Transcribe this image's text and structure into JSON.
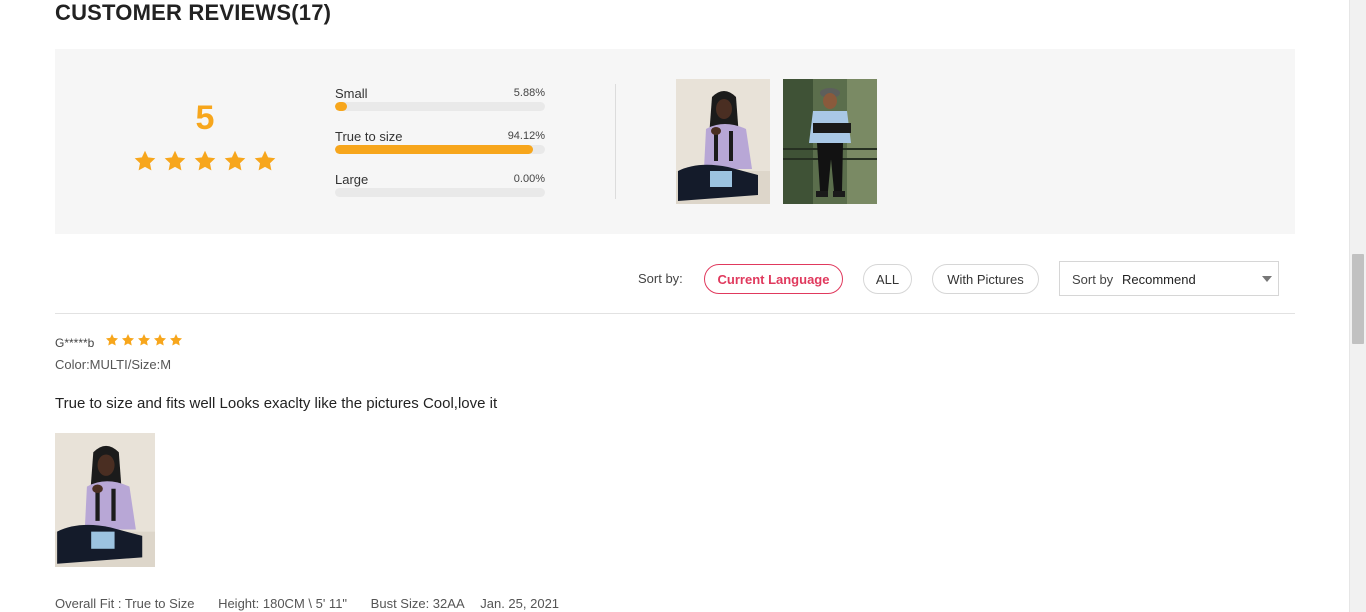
{
  "title": "CUSTOMER REVIEWS(17)",
  "summary": {
    "average": "5",
    "average_stars": 5,
    "fit": [
      {
        "label": "Small",
        "percent_text": "5.88%",
        "percent": 5.88
      },
      {
        "label": "True to size",
        "percent_text": "94.12%",
        "percent": 94.12
      },
      {
        "label": "Large",
        "percent_text": "0.00%",
        "percent": 0
      }
    ],
    "photos": [
      "customer-photo-seated",
      "customer-photo-standing"
    ]
  },
  "sort": {
    "label": "Sort by:",
    "filters": [
      "Current Language",
      "ALL",
      "With Pictures"
    ],
    "active_filter": "Current Language",
    "select_prefix": "Sort by",
    "select_value": "Recommend"
  },
  "review": {
    "reviewer": "G*****b",
    "stars": 5,
    "variant": "Color:MULTI/Size:M",
    "comment": "True to size and fits well Looks exaclty like the pictures Cool,love it",
    "overall_fit": "Overall Fit : True to Size",
    "height": "Height: 180CM \\ 5' 11\"",
    "bust_size": "Bust Size: 32AA",
    "date": "Jan. 25, 2021"
  },
  "colors": {
    "accent_star": "#f7a61c",
    "active_filter": "#e0395d",
    "summary_bg": "#f6f6f6"
  }
}
